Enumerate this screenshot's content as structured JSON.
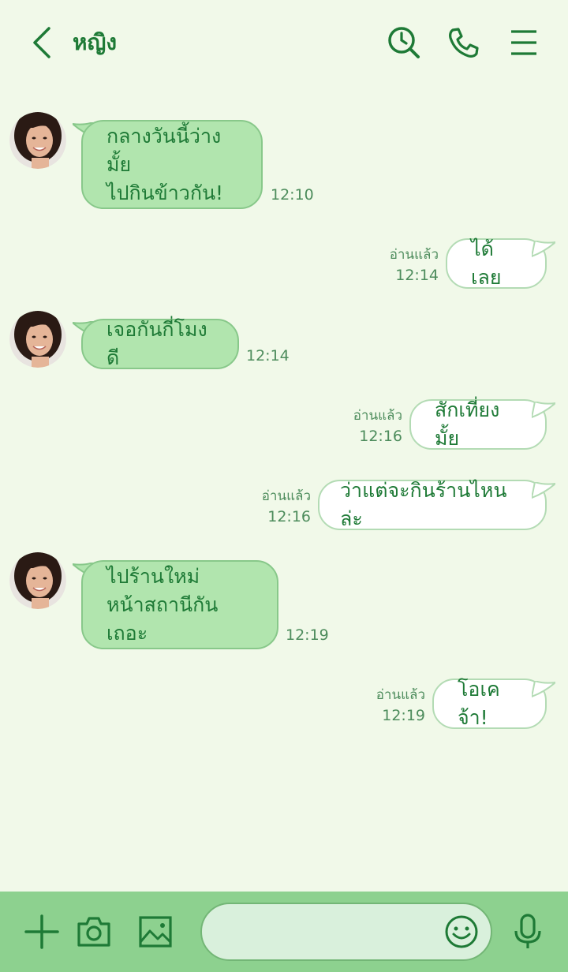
{
  "header": {
    "title": "หญิง",
    "back_icon": "chevron-left-icon",
    "search_icon": "search-history-icon",
    "call_icon": "phone-icon",
    "menu_icon": "hamburger-menu-icon"
  },
  "messages": [
    {
      "side": "in",
      "lines": [
        "กลางวันนี้ว่างมั้ย",
        "ไปกินข้าวกัน!"
      ],
      "time": "12:10"
    },
    {
      "side": "out",
      "lines": [
        "ได้เลย"
      ],
      "read": "อ่านแล้ว",
      "time": "12:14"
    },
    {
      "side": "in",
      "lines": [
        "เจอกันกี่โมงดี"
      ],
      "time": "12:14"
    },
    {
      "side": "out",
      "lines": [
        "สักเที่ยงมั้ย"
      ],
      "read": "อ่านแล้ว",
      "time": "12:16"
    },
    {
      "side": "out",
      "lines": [
        "ว่าแต่จะกินร้านไหนล่ะ"
      ],
      "read": "อ่านแล้ว",
      "time": "12:16"
    },
    {
      "side": "in",
      "lines": [
        "ไปร้านใหม่",
        "หน้าสถานีกันเถอะ"
      ],
      "time": "12:19"
    },
    {
      "side": "out",
      "lines": [
        "โอเคจ้า!"
      ],
      "read": "อ่านแล้ว",
      "time": "12:19"
    }
  ],
  "bottom_bar": {
    "plus_icon": "plus-icon",
    "camera_icon": "camera-icon",
    "image_icon": "image-icon",
    "input_placeholder": "",
    "emoji_icon": "smiley-icon",
    "mic_icon": "microphone-icon"
  },
  "colors": {
    "background": "#f1f9e9",
    "accent": "#1e7a36",
    "incoming_bubble": "#b1e5ae",
    "outgoing_bubble": "#ffffff",
    "bottom_bar": "#8dd18f"
  }
}
